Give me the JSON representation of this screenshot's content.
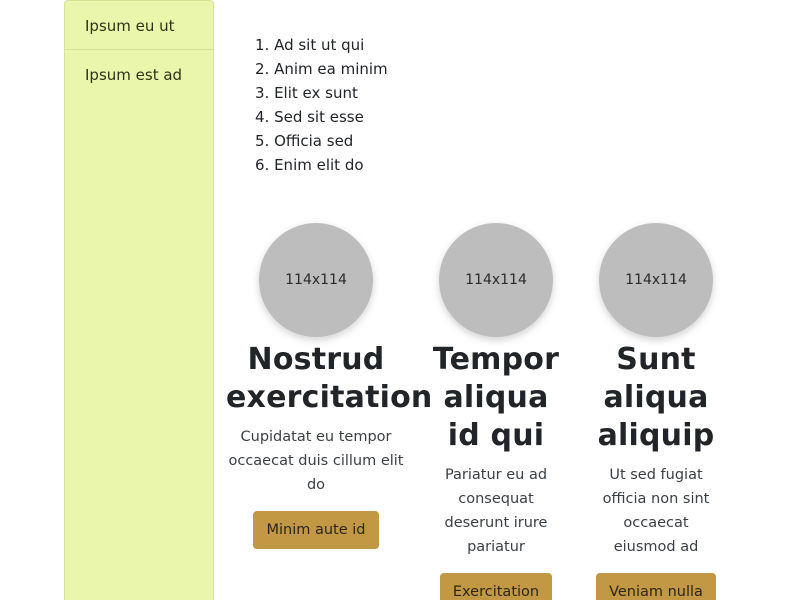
{
  "sidebar": {
    "items": [
      {
        "label": "Ipsum eu ut"
      },
      {
        "label": "Ipsum est ad"
      }
    ]
  },
  "list": {
    "items": [
      "1. Ad sit ut qui",
      "2. Anim ea minim",
      "3. Elit ex sunt",
      "4. Sed sit esse",
      "5. Officia sed",
      "6. Enim elit do"
    ]
  },
  "features": [
    {
      "image_label": "114x114",
      "title": "Nostrud exercitation",
      "text": "Cupidatat eu tempor occaecat duis cillum elit do",
      "button": "Minim aute id"
    },
    {
      "image_label": "114x114",
      "title": "Tempor aliqua id qui",
      "text": "Pariatur eu ad consequat deserunt irure pariatur",
      "button": "Exercitation"
    },
    {
      "image_label": "114x114",
      "title": "Sunt aliqua aliquip",
      "text": "Ut sed fugiat officia non sint occaecat eiusmod ad",
      "button": "Veniam nulla"
    }
  ],
  "colors": {
    "sidebar_bg": "#eaf6ab",
    "button_bg": "#c29845",
    "avatar_bg": "#bdbdbd"
  }
}
